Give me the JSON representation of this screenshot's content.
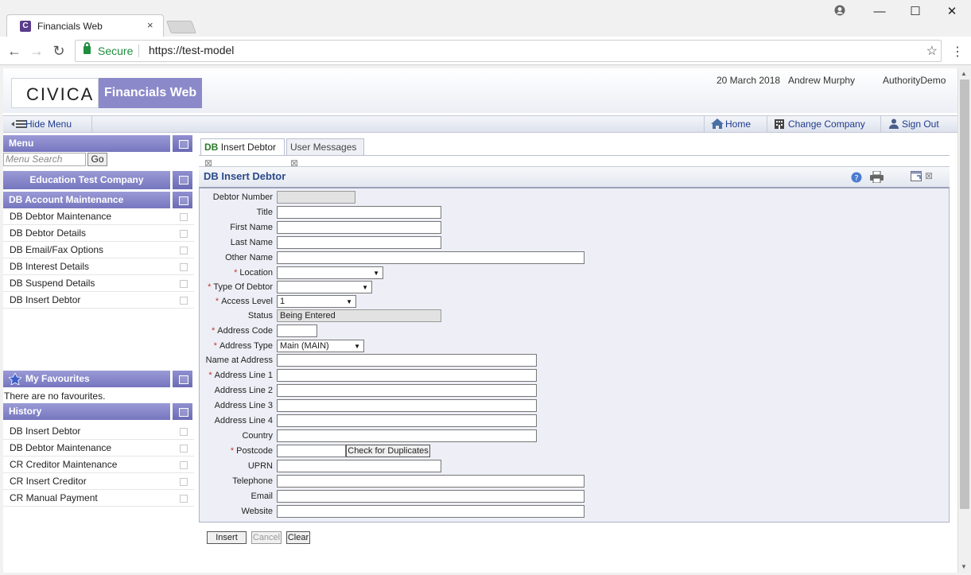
{
  "browser": {
    "tab_title": "Financials Web",
    "tab_close": "×",
    "secure_label": "Secure",
    "url": "https://test-model",
    "min": "—",
    "max": "☐",
    "close": "✕"
  },
  "header": {
    "logo": "CIVICA",
    "brand": "Financials Web",
    "date": "20 March 2018",
    "user": "Andrew Murphy",
    "authority": "AuthorityDemo"
  },
  "navbar": {
    "hide_menu": "Hide Menu",
    "home": "Home",
    "change_company": "Change Company",
    "sign_out": "Sign Out"
  },
  "menu": {
    "title": "Menu",
    "search_placeholder": "Menu Search",
    "go": "Go",
    "company": "Education Test Company",
    "section": "DB Account Maintenance",
    "items": [
      "DB Debtor Maintenance",
      "DB Debtor Details",
      "DB Email/Fax Options",
      "DB Interest Details",
      "DB Suspend Details",
      "DB Insert Debtor"
    ]
  },
  "favourites": {
    "title": "My Favourites",
    "empty": "There are no favourites."
  },
  "history": {
    "title": "History",
    "items": [
      "DB Insert Debtor",
      "DB Debtor Maintenance",
      "CR Creditor Maintenance",
      "CR Insert Creditor",
      "CR Manual Payment"
    ]
  },
  "tabs": {
    "active_prefix": "DB",
    "active": "Insert Debtor",
    "second": "User Messages",
    "close": "⊠"
  },
  "form": {
    "title": "DB Insert Debtor",
    "fields": {
      "debtor_number": {
        "label": "Debtor Number",
        "value": ""
      },
      "title": {
        "label": "Title",
        "value": ""
      },
      "first_name": {
        "label": "First Name",
        "value": ""
      },
      "last_name": {
        "label": "Last Name",
        "value": ""
      },
      "other_name": {
        "label": "Other Name",
        "value": ""
      },
      "location": {
        "label": "Location",
        "value": ""
      },
      "type_of_debtor": {
        "label": "Type Of Debtor",
        "value": ""
      },
      "access_level": {
        "label": "Access Level",
        "value": "1"
      },
      "status": {
        "label": "Status",
        "value": "Being Entered"
      },
      "address_code": {
        "label": "Address Code",
        "value": ""
      },
      "address_type": {
        "label": "Address Type",
        "value": "Main (MAIN)"
      },
      "name_at_address": {
        "label": "Name at Address",
        "value": ""
      },
      "address_line_1": {
        "label": "Address Line 1",
        "value": ""
      },
      "address_line_2": {
        "label": "Address Line 2",
        "value": ""
      },
      "address_line_3": {
        "label": "Address Line 3",
        "value": ""
      },
      "address_line_4": {
        "label": "Address Line 4",
        "value": ""
      },
      "country": {
        "label": "Country",
        "value": ""
      },
      "postcode": {
        "label": "Postcode",
        "value": ""
      },
      "uprn": {
        "label": "UPRN",
        "value": ""
      },
      "telephone": {
        "label": "Telephone",
        "value": ""
      },
      "email": {
        "label": "Email",
        "value": ""
      },
      "website": {
        "label": "Website",
        "value": ""
      }
    },
    "required_mark": "*",
    "check_duplicates": "Check for Duplicates"
  },
  "actions": {
    "insert": "Insert",
    "cancel": "Cancel",
    "clear": "Clear"
  }
}
